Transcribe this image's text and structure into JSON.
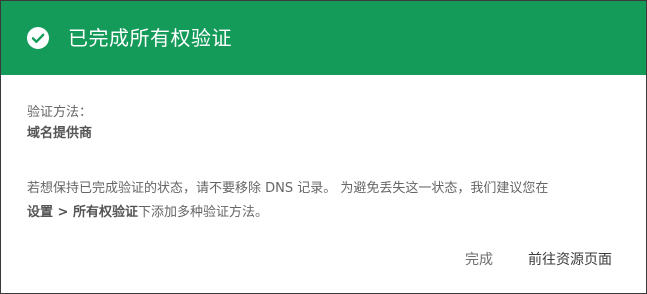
{
  "dialog": {
    "title": "已完成所有权验证",
    "icon": "check-circle-icon",
    "header_color": "#149b5a"
  },
  "verification": {
    "label": "验证方法：",
    "method": "域名提供商"
  },
  "info": {
    "line1": "若想保持已完成验证的状态，请不要移除 DNS 记录。 为避免丢失这一状态，我们建议您在",
    "settings_link": "设置 > 所有权验证",
    "line2_rest": "下添加多种验证方法。"
  },
  "actions": {
    "done_label": "完成",
    "goto_label": "前往资源页面"
  }
}
